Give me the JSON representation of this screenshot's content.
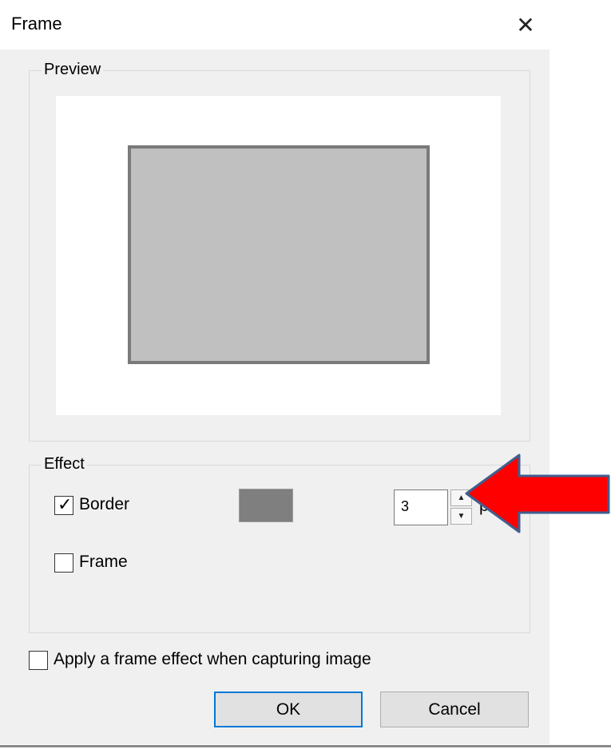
{
  "dialog": {
    "title": "Frame",
    "close_glyph": "✕"
  },
  "preview": {
    "label": "Preview",
    "frame_fill": "#c0c0c0",
    "frame_border_color": "#7a7a7a"
  },
  "effect": {
    "label": "Effect",
    "border": {
      "label": "Border",
      "checked": true,
      "check_glyph": "✓",
      "color": "#7f7f7f",
      "width_value": "3",
      "unit": "px"
    },
    "frame": {
      "label": "Frame",
      "checked": false
    }
  },
  "apply_on_capture": {
    "label": "Apply a frame effect when capturing image",
    "checked": false
  },
  "buttons": {
    "ok": "OK",
    "cancel": "Cancel"
  },
  "annotation": {
    "icon": "red-arrow-icon",
    "color": "#ff0000",
    "outline": "#3f5f8f"
  }
}
